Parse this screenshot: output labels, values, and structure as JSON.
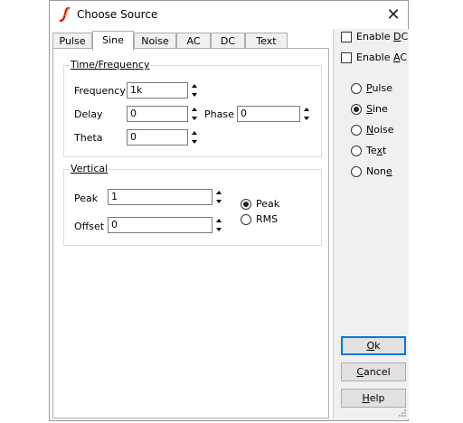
{
  "window": {
    "title": "Choose Source",
    "close_glyph": "✕"
  },
  "tabs": [
    {
      "label": "Pulse",
      "active": false
    },
    {
      "label": "Sine",
      "active": true
    },
    {
      "label": "Noise",
      "active": false
    },
    {
      "label": "AC",
      "active": false
    },
    {
      "label": "DC",
      "active": false
    },
    {
      "label": "Text",
      "active": false
    }
  ],
  "time_group": {
    "title": "Time/Frequency",
    "frequency": {
      "label": "Frequency",
      "value": "1k"
    },
    "delay": {
      "label": "Delay",
      "value": "0"
    },
    "phase": {
      "label": "Phase",
      "value": "0"
    },
    "theta": {
      "label": "Theta",
      "value": "0"
    }
  },
  "vertical_group": {
    "title": "Vertical",
    "peak": {
      "label": "Peak",
      "value": "1"
    },
    "offset": {
      "label": "Offset",
      "value": "0"
    },
    "mode_options": [
      {
        "label": "Peak",
        "selected": true
      },
      {
        "label": "RMS",
        "selected": false
      }
    ]
  },
  "right_panel": {
    "enable_dc": {
      "pre": "Enable ",
      "key": "D",
      "post": "C",
      "checked": false
    },
    "enable_ac": {
      "pre": "Enable ",
      "key": "A",
      "post": "C",
      "checked": false
    },
    "source_types": [
      {
        "pre": "",
        "key": "P",
        "post": "ulse",
        "selected": false
      },
      {
        "pre": "",
        "key": "S",
        "post": "ine",
        "selected": true
      },
      {
        "pre": "",
        "key": "N",
        "post": "oise",
        "selected": false
      },
      {
        "pre": "Te",
        "key": "x",
        "post": "t",
        "selected": false
      },
      {
        "pre": "Non",
        "key": "e",
        "post": "",
        "selected": false
      }
    ],
    "ok_button": {
      "pre": "",
      "key": "O",
      "post": "k"
    },
    "cancel_button": {
      "pre": "",
      "key": "C",
      "post": "ancel"
    },
    "help_button": {
      "pre": "",
      "key": "H",
      "post": "elp"
    }
  },
  "colors": {
    "accent": "#0078d7",
    "dialog_bg": "#f0f0f0",
    "icon_red": "#d41c1c",
    "icon_orange": "#f39c12"
  }
}
